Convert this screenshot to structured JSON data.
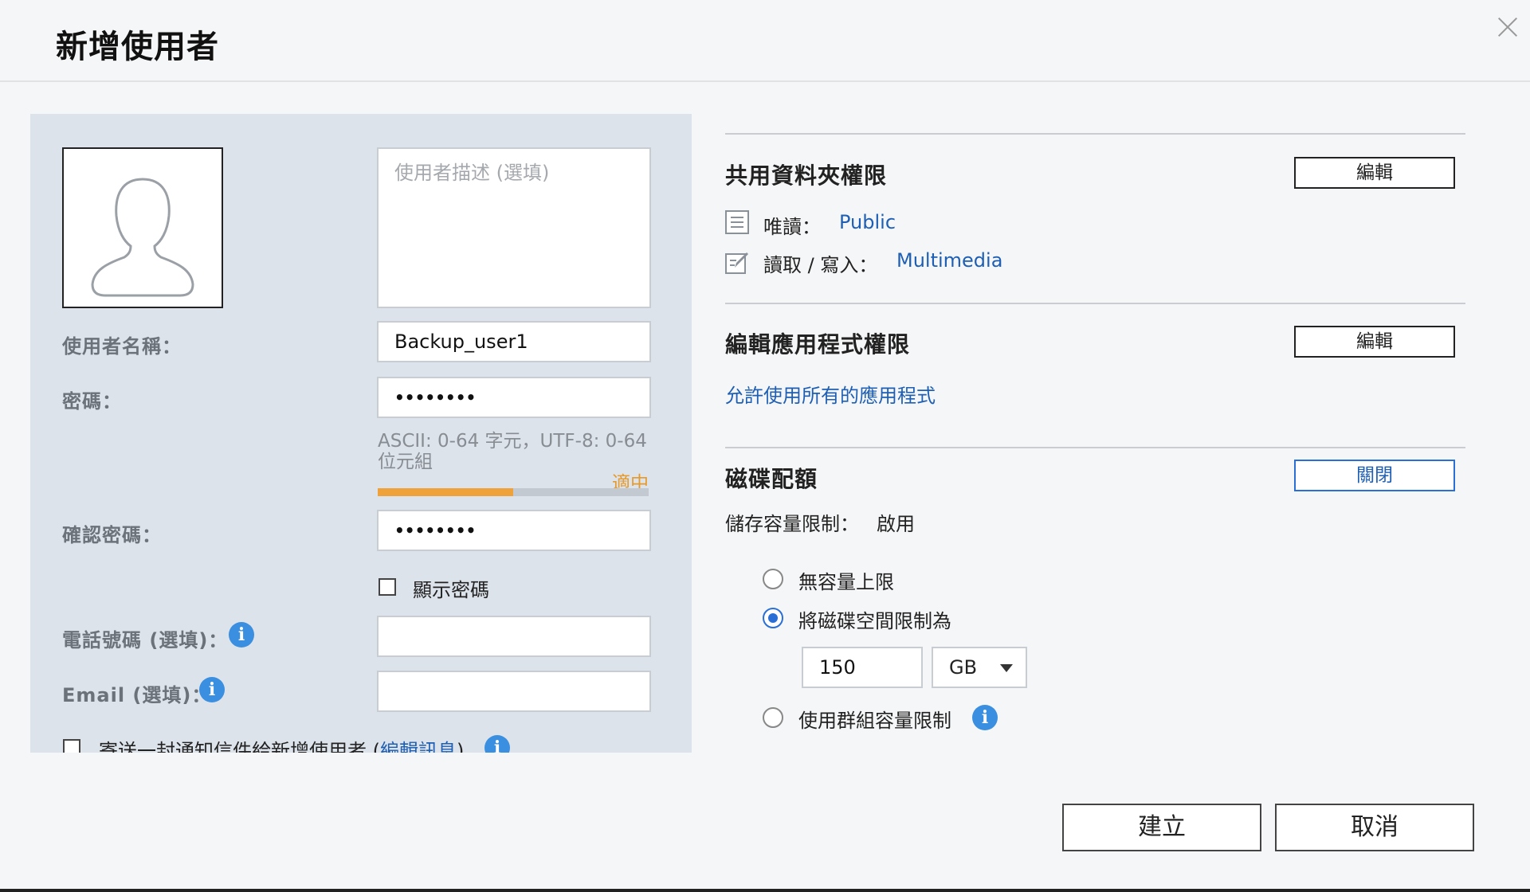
{
  "dialog": {
    "title": "新增使用者"
  },
  "left": {
    "description_placeholder": "使用者描述 (選填)",
    "username_label": "使用者名稱：",
    "username_value": "Backup_user1",
    "password_label": "密碼：",
    "password_value": "••••••••",
    "password_hint": "ASCII: 0-64 字元，UTF-8: 0-64 位元組",
    "strength_label": "適中",
    "strength_level": 0.5,
    "confirm_label": "確認密碼：",
    "confirm_value": "••••••••",
    "show_password_label": "顯示密碼",
    "phone_label": "電話號碼 (選填)：",
    "email_label": "Email (選填)：",
    "notify_text": "寄送一封通知信件給新增使用者 (",
    "notify_link": "編輯訊息",
    "notify_close": ")"
  },
  "shared_folder": {
    "title": "共用資料夾權限",
    "edit_label": "編輯",
    "read_only_label": "唯讀：",
    "read_only_value": "Public",
    "read_write_label": "讀取 / 寫入：",
    "read_write_value": "Multimedia"
  },
  "app_permission": {
    "title": "編輯應用程式權限",
    "edit_label": "編輯",
    "allow_all_link": "允許使用所有的應用程式"
  },
  "quota": {
    "title": "磁碟配額",
    "toggle_label": "關閉",
    "limit_label": "儲存容量限制：",
    "limit_value": "啟用",
    "options": [
      "無容量上限",
      "將磁碟空間限制為",
      "使用群組容量限制"
    ],
    "selected_option": 1,
    "amount": "150",
    "unit": "GB"
  },
  "footer": {
    "create_label": "建立",
    "cancel_label": "取消"
  },
  "colors": {
    "accent": "#2a6fd6",
    "link": "#1e5fb4",
    "strength": "#f0a23a",
    "panel": "#dde3eb"
  }
}
